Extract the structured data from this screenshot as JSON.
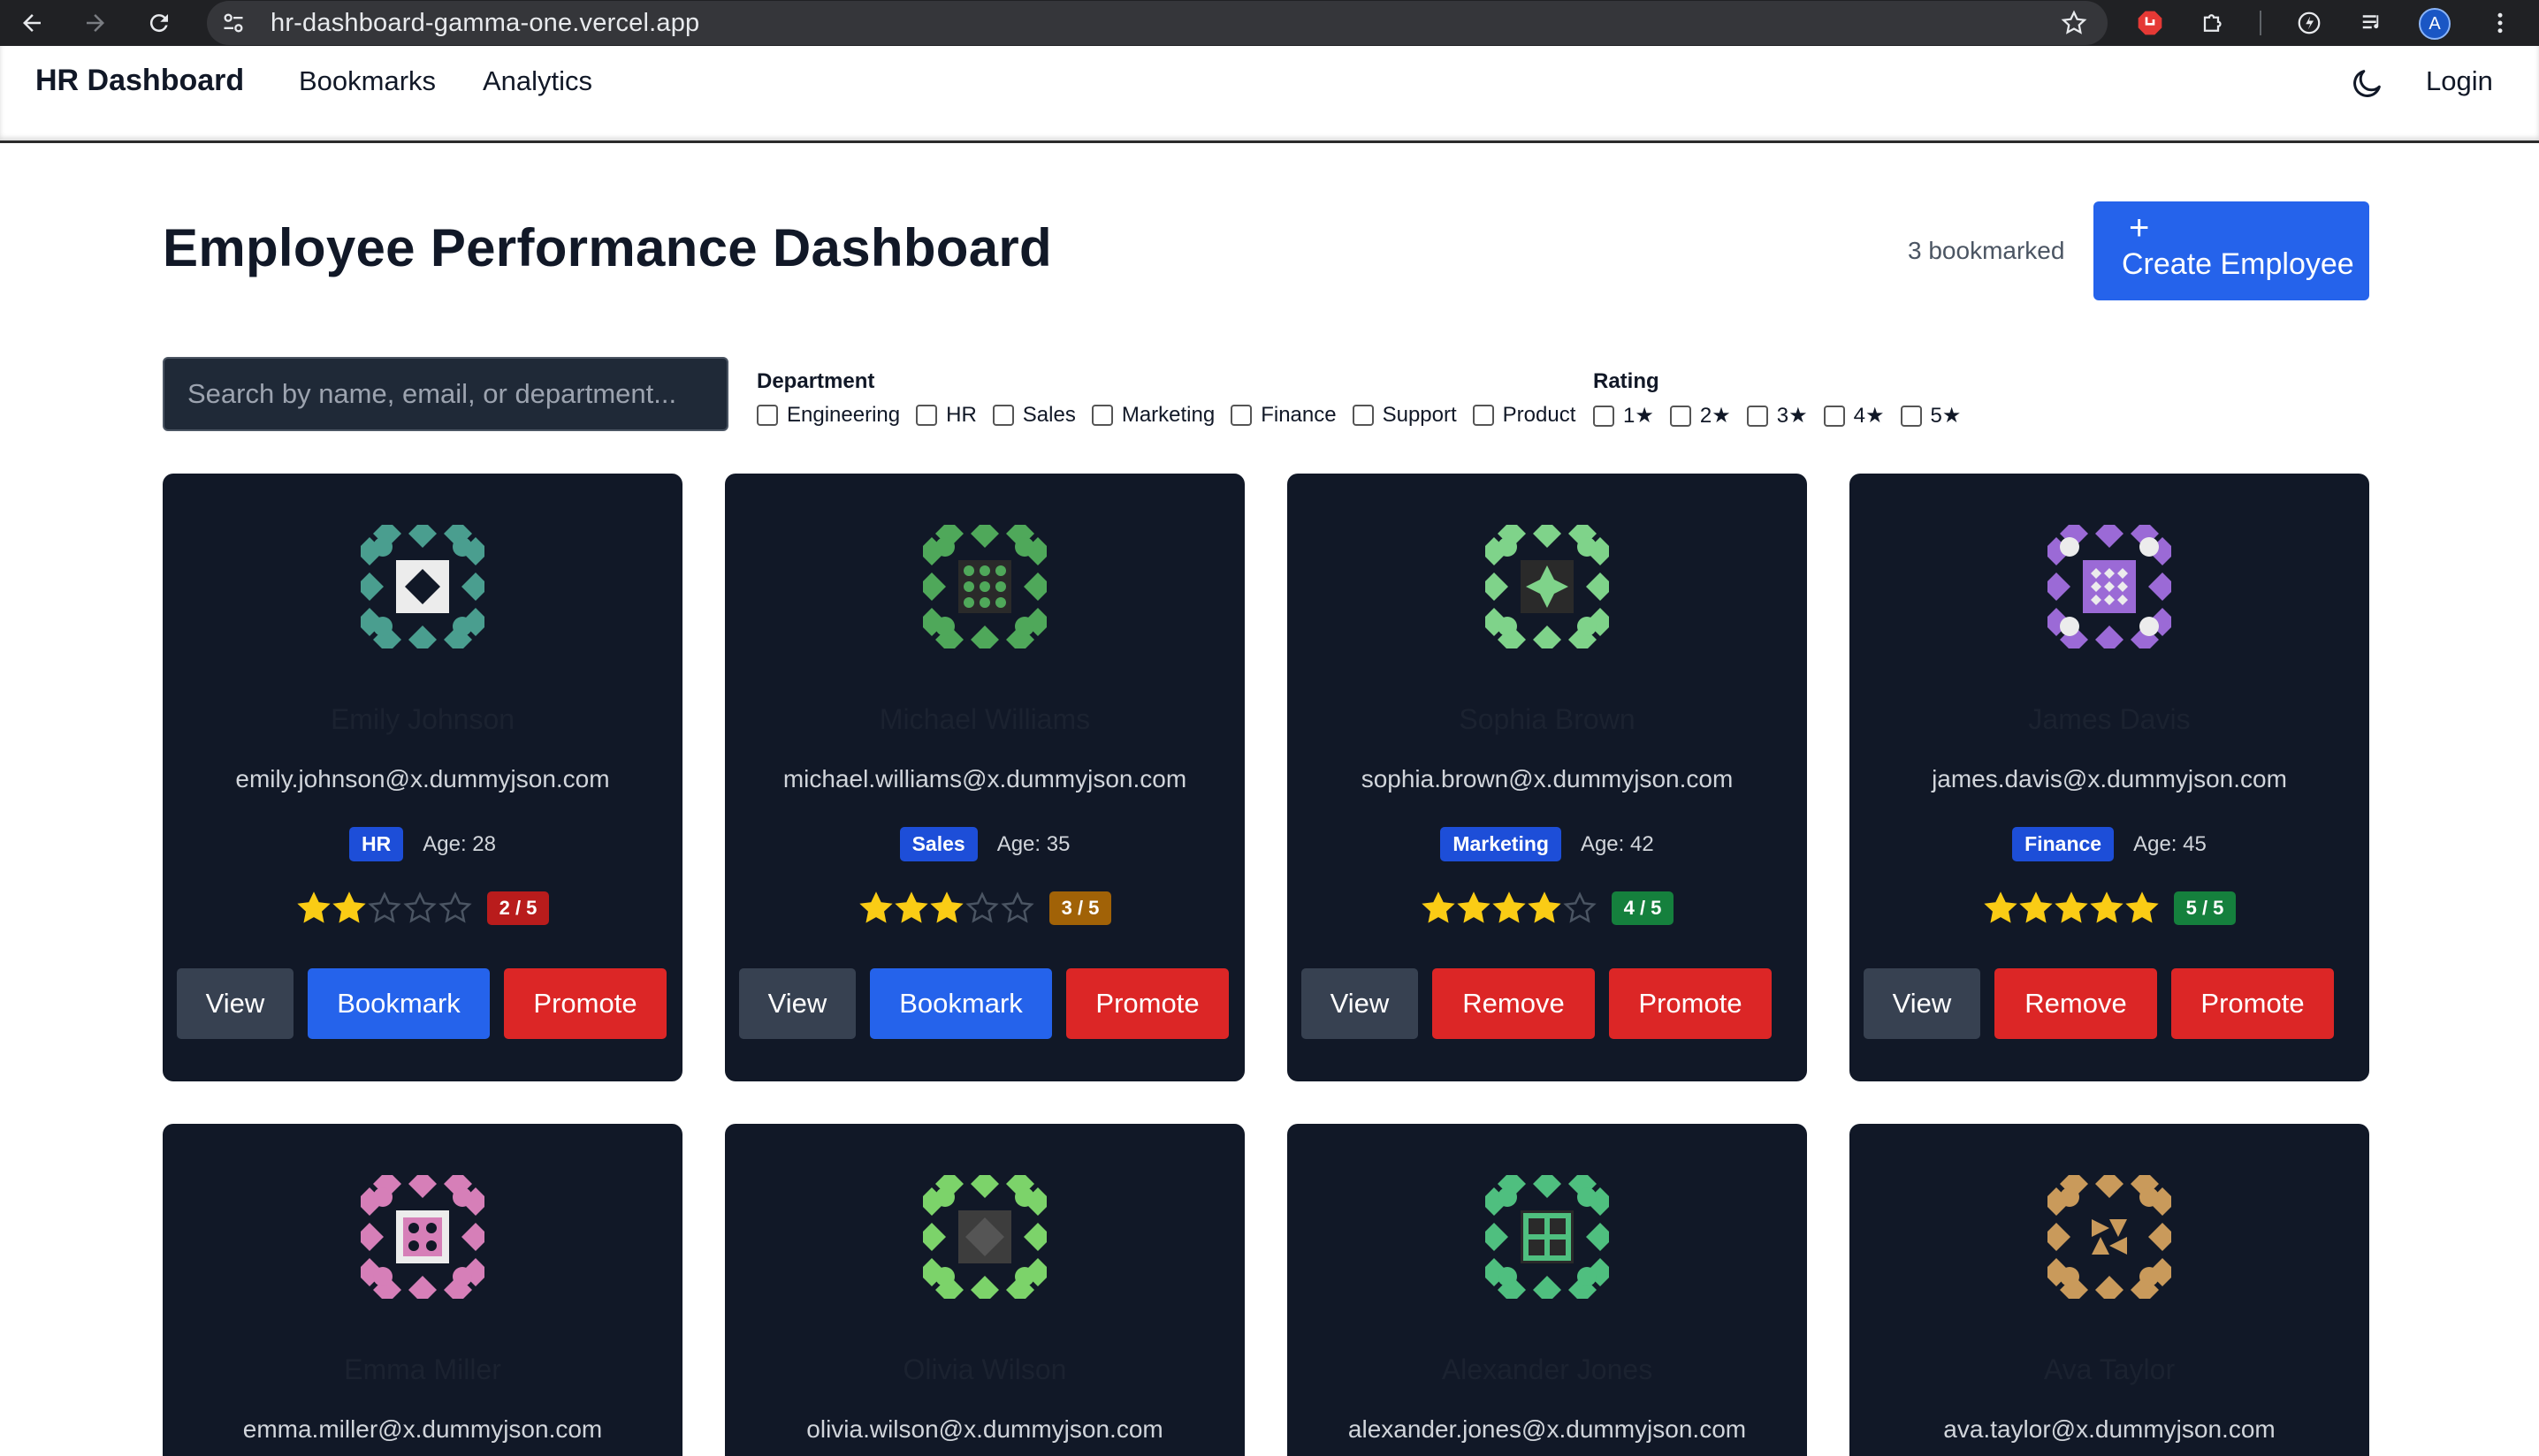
{
  "browser": {
    "url": "hr-dashboard-gamma-one.vercel.app",
    "profile_initial": "A"
  },
  "navbar": {
    "brand": "HR Dashboard",
    "links": [
      "Bookmarks",
      "Analytics"
    ],
    "login": "Login",
    "theme_icon": "moon-icon"
  },
  "header": {
    "title": "Employee Performance Dashboard",
    "bookmarked_count": "3 bookmarked",
    "create_plus": "+",
    "create_label": "Create Employee"
  },
  "filters": {
    "search_placeholder": "Search by name, email, or department...",
    "department_title": "Department",
    "departments": [
      "Engineering",
      "HR",
      "Sales",
      "Marketing",
      "Finance",
      "Support",
      "Product"
    ],
    "rating_title": "Rating",
    "ratings": [
      "1★",
      "2★",
      "3★",
      "4★",
      "5★"
    ]
  },
  "colors": {
    "primary": "#2563eb",
    "danger": "#dc2626",
    "card_bg": "#111827",
    "star": "#facc15"
  },
  "employees": [
    {
      "name": "Emily Johnson",
      "email": "emily.johnson@x.dummyjson.com",
      "department": "HR",
      "age": "Age: 28",
      "rating": 2,
      "rating_label": "2 / 5",
      "rating_color": "#b91c1c",
      "primary_action": "Bookmark",
      "promote": "Promote",
      "view": "View",
      "avatar_color": "#4a9e8f"
    },
    {
      "name": "Michael Williams",
      "email": "michael.williams@x.dummyjson.com",
      "department": "Sales",
      "age": "Age: 35",
      "rating": 3,
      "rating_label": "3 / 5",
      "rating_color": "#a16207",
      "primary_action": "Bookmark",
      "promote": "Promote",
      "view": "View",
      "avatar_color": "#4fa85a"
    },
    {
      "name": "Sophia Brown",
      "email": "sophia.brown@x.dummyjson.com",
      "department": "Marketing",
      "age": "Age: 42",
      "rating": 4,
      "rating_label": "4 / 5",
      "rating_color": "#15803d",
      "primary_action": "Remove",
      "promote": "Promote",
      "view": "View",
      "avatar_color": "#7fd38a"
    },
    {
      "name": "James Davis",
      "email": "james.davis@x.dummyjson.com",
      "department": "Finance",
      "age": "Age: 45",
      "rating": 5,
      "rating_label": "5 / 5",
      "rating_color": "#15803d",
      "primary_action": "Remove",
      "promote": "Promote",
      "view": "View",
      "avatar_color": "#9b6ad6"
    },
    {
      "name": "Emma Miller",
      "email": "emma.miller@x.dummyjson.com",
      "avatar_color": "#d67fb8"
    },
    {
      "name": "Olivia Wilson",
      "email": "olivia.wilson@x.dummyjson.com",
      "avatar_color": "#7cd36a"
    },
    {
      "name": "Alexander Jones",
      "email": "alexander.jones@x.dummyjson.com",
      "avatar_color": "#4fbf7f"
    },
    {
      "name": "Ava Taylor",
      "email": "ava.taylor@x.dummyjson.com",
      "avatar_color": "#c99a5b"
    }
  ]
}
